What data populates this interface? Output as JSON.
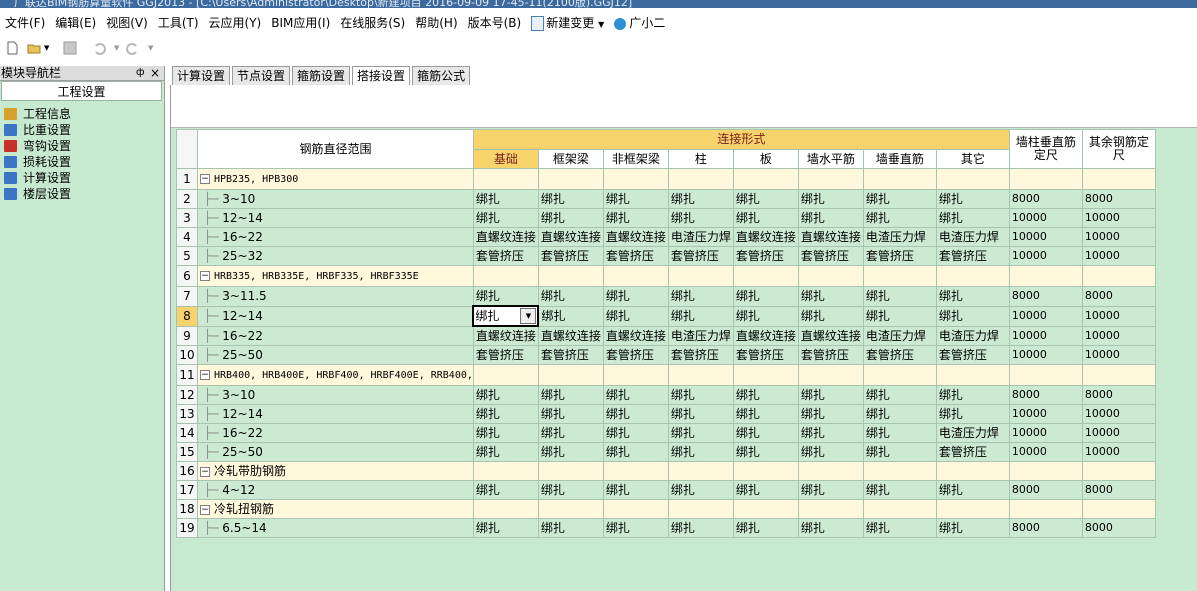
{
  "window": {
    "title_partial": "广联达BIM钢筋算量软件 GGJ2013 - [C:\\Users\\Administrator\\Desktop\\新建项目 2016-09-09 17-45-11(2100版).GGJ12]"
  },
  "menu": [
    "文件(F)",
    "编辑(E)",
    "视图(V)",
    "工具(T)",
    "云应用(Y)",
    "BIM应用(I)",
    "在线服务(S)",
    "帮助(H)",
    "版本号(B)",
    "新建变更",
    "广小二"
  ],
  "nav": {
    "header": "模块导航栏",
    "pin": "ф",
    "close": "×",
    "section": "工程设置",
    "items": [
      {
        "label": "工程信息",
        "icon": "project-info-icon",
        "color": "#d6a12a"
      },
      {
        "label": "比重设置",
        "icon": "weight-setting-icon",
        "color": "#3a76c4"
      },
      {
        "label": "弯钩设置",
        "icon": "hook-setting-icon",
        "color": "#c8312b"
      },
      {
        "label": "损耗设置",
        "icon": "loss-setting-icon",
        "color": "#3a76c4"
      },
      {
        "label": "计算设置",
        "icon": "calc-setting-icon",
        "color": "#3a76c4"
      },
      {
        "label": "楼层设置",
        "icon": "floor-setting-icon",
        "color": "#3a76c4"
      }
    ]
  },
  "tabs": [
    "计算设置",
    "节点设置",
    "箍筋设置",
    "搭接设置",
    "箍筋公式"
  ],
  "active_tab": 3,
  "table": {
    "header": {
      "diameter_range": "钢筋直径范围",
      "connection_form": "连接形式",
      "columns": [
        "基础",
        "框架梁",
        "非框架梁",
        "柱",
        "板",
        "墙水平筋",
        "墙垂直筋",
        "其它"
      ],
      "wall_col_length_l1": "墙柱垂直筋",
      "wall_col_length_l2": "定尺",
      "other_length_l1": "其余钢筋定",
      "other_length_l2": "尺"
    },
    "rows": [
      {
        "n": "1",
        "type": "group",
        "name": "HPB235, HPB300"
      },
      {
        "n": "2",
        "type": "data",
        "name": "3~10",
        "c": [
          "绑扎",
          "绑扎",
          "绑扎",
          "绑扎",
          "绑扎",
          "绑扎",
          "绑扎",
          "绑扎"
        ],
        "l1": "8000",
        "l2": "8000"
      },
      {
        "n": "3",
        "type": "data",
        "name": "12~14",
        "c": [
          "绑扎",
          "绑扎",
          "绑扎",
          "绑扎",
          "绑扎",
          "绑扎",
          "绑扎",
          "绑扎"
        ],
        "l1": "10000",
        "l2": "10000"
      },
      {
        "n": "4",
        "type": "data",
        "name": "16~22",
        "c": [
          "直螺纹连接",
          "直螺纹连接",
          "直螺纹连接",
          "电渣压力焊",
          "直螺纹连接",
          "直螺纹连接",
          "电渣压力焊",
          "电渣压力焊"
        ],
        "l1": "10000",
        "l2": "10000"
      },
      {
        "n": "5",
        "type": "data",
        "name": "25~32",
        "c": [
          "套管挤压",
          "套管挤压",
          "套管挤压",
          "套管挤压",
          "套管挤压",
          "套管挤压",
          "套管挤压",
          "套管挤压"
        ],
        "l1": "10000",
        "l2": "10000"
      },
      {
        "n": "6",
        "type": "group",
        "name": "HRB335, HRB335E, HRBF335, HRBF335E"
      },
      {
        "n": "7",
        "type": "data",
        "name": "3~11.5",
        "c": [
          "绑扎",
          "绑扎",
          "绑扎",
          "绑扎",
          "绑扎",
          "绑扎",
          "绑扎",
          "绑扎"
        ],
        "l1": "8000",
        "l2": "8000"
      },
      {
        "n": "8",
        "type": "data",
        "name": "12~14",
        "c": [
          "绑扎",
          "绑扎",
          "绑扎",
          "绑扎",
          "绑扎",
          "绑扎",
          "绑扎",
          "绑扎"
        ],
        "l1": "10000",
        "l2": "10000",
        "selected": true
      },
      {
        "n": "9",
        "type": "data",
        "name": "16~22",
        "c": [
          "直螺纹连接",
          "直螺纹连接",
          "直螺纹连接",
          "电渣压力焊",
          "直螺纹连接",
          "直螺纹连接",
          "电渣压力焊",
          "电渣压力焊"
        ],
        "l1": "10000",
        "l2": "10000"
      },
      {
        "n": "10",
        "type": "data",
        "name": "25~50",
        "c": [
          "套管挤压",
          "套管挤压",
          "套管挤压",
          "套管挤压",
          "套管挤压",
          "套管挤压",
          "套管挤压",
          "套管挤压"
        ],
        "l1": "10000",
        "l2": "10000"
      },
      {
        "n": "11",
        "type": "group",
        "name": "HRB400, HRB400E, HRBF400, HRBF400E, RRB400,"
      },
      {
        "n": "12",
        "type": "data",
        "name": "3~10",
        "c": [
          "绑扎",
          "绑扎",
          "绑扎",
          "绑扎",
          "绑扎",
          "绑扎",
          "绑扎",
          "绑扎"
        ],
        "l1": "8000",
        "l2": "8000"
      },
      {
        "n": "13",
        "type": "data",
        "name": "12~14",
        "c": [
          "绑扎",
          "绑扎",
          "绑扎",
          "绑扎",
          "绑扎",
          "绑扎",
          "绑扎",
          "绑扎"
        ],
        "l1": "10000",
        "l2": "10000"
      },
      {
        "n": "14",
        "type": "data",
        "name": "16~22",
        "c": [
          "绑扎",
          "绑扎",
          "绑扎",
          "绑扎",
          "绑扎",
          "绑扎",
          "绑扎",
          "电渣压力焊"
        ],
        "l1": "10000",
        "l2": "10000"
      },
      {
        "n": "15",
        "type": "data",
        "name": "25~50",
        "c": [
          "绑扎",
          "绑扎",
          "绑扎",
          "绑扎",
          "绑扎",
          "绑扎",
          "绑扎",
          "套管挤压"
        ],
        "l1": "10000",
        "l2": "10000"
      },
      {
        "n": "16",
        "type": "group",
        "name": "冷轧带肋钢筋"
      },
      {
        "n": "17",
        "type": "data",
        "name": "4~12",
        "c": [
          "绑扎",
          "绑扎",
          "绑扎",
          "绑扎",
          "绑扎",
          "绑扎",
          "绑扎",
          "绑扎"
        ],
        "l1": "8000",
        "l2": "8000"
      },
      {
        "n": "18",
        "type": "group",
        "name": "冷轧扭钢筋"
      },
      {
        "n": "19",
        "type": "data",
        "name": "6.5~14",
        "c": [
          "绑扎",
          "绑扎",
          "绑扎",
          "绑扎",
          "绑扎",
          "绑扎",
          "绑扎",
          "绑扎"
        ],
        "l1": "8000",
        "l2": "8000"
      }
    ]
  }
}
